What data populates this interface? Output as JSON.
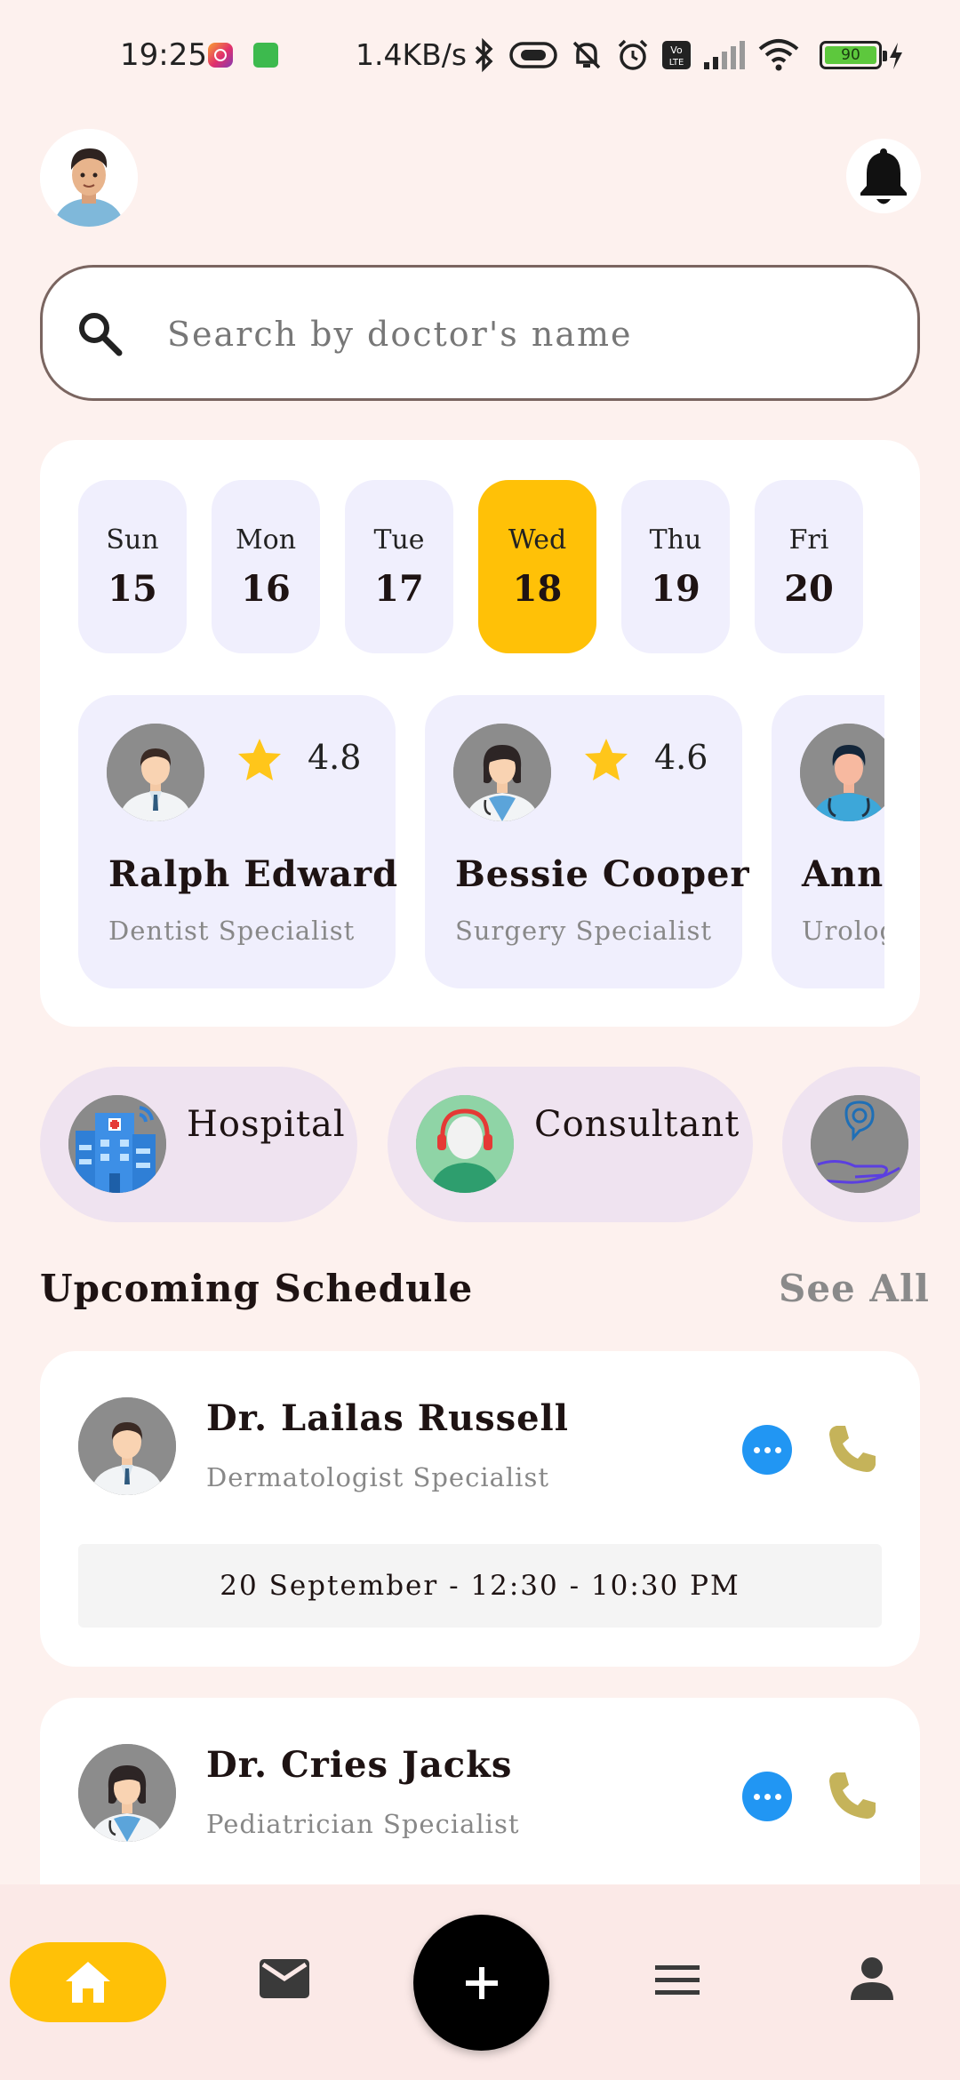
{
  "status_bar": {
    "time": "19:25",
    "network_speed": "1.4KB/s",
    "battery": "90"
  },
  "search": {
    "placeholder": "Search by doctor's name"
  },
  "days": [
    {
      "name": "Sun",
      "num": "15",
      "active": false
    },
    {
      "name": "Mon",
      "num": "16",
      "active": false
    },
    {
      "name": "Tue",
      "num": "17",
      "active": false
    },
    {
      "name": "Wed",
      "num": "18",
      "active": true
    },
    {
      "name": "Thu",
      "num": "19",
      "active": false
    },
    {
      "name": "Fri",
      "num": "20",
      "active": false
    }
  ],
  "doctors": [
    {
      "name": "Ralph Edward",
      "specialty": "Dentist Specialist",
      "rating": "4.8"
    },
    {
      "name": "Bessie Cooper",
      "specialty": "Surgery Specialist",
      "rating": "4.6"
    },
    {
      "name": "Anne",
      "specialty": "Urolog",
      "rating": ""
    }
  ],
  "categories": [
    {
      "label": "Hospital",
      "icon": "hospital-icon"
    },
    {
      "label": "Consultant",
      "icon": "consultant-icon"
    },
    {
      "label": "",
      "icon": "care-icon"
    }
  ],
  "schedule": {
    "title": "Upcoming Schedule",
    "see_all": "See All",
    "items": [
      {
        "name": "Dr. Lailas Russell",
        "specialty": "Dermatologist Specialist",
        "time": "20 September - 12:30 - 10:30 PM"
      },
      {
        "name": "Dr. Cries Jacks",
        "specialty": "Pediatrician Specialist"
      }
    ]
  },
  "colors": {
    "accent": "#FFC107",
    "background": "#FDF1EE",
    "day_chip": "#F0EFFD",
    "category_chip": "#EFE3F0",
    "more_button": "#2196F3",
    "call_icon": "#C5B35A"
  },
  "nav": [
    "home-icon",
    "mail-icon",
    "add-icon",
    "menu-icon",
    "profile-icon"
  ]
}
